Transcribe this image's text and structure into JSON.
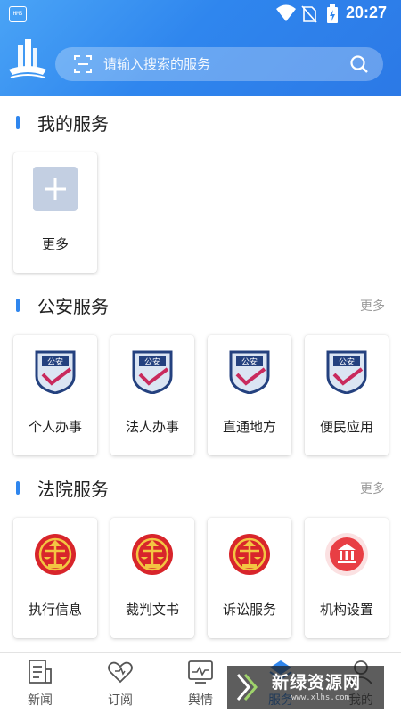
{
  "status_bar": {
    "time": "20:27",
    "sim_label": "HMS"
  },
  "search": {
    "placeholder": "请输入搜索的服务"
  },
  "my_services": {
    "title": "我的服务",
    "items": [
      {
        "label": "更多",
        "icon": "plus-icon"
      }
    ]
  },
  "police_services": {
    "title": "公安服务",
    "more": "更多",
    "badge_text": "公安",
    "items": [
      {
        "label": "个人办事",
        "icon": "police-badge-icon"
      },
      {
        "label": "法人办事",
        "icon": "police-badge-icon"
      },
      {
        "label": "直通地方",
        "icon": "police-badge-icon"
      },
      {
        "label": "便民应用",
        "icon": "police-badge-icon"
      }
    ]
  },
  "court_services": {
    "title": "法院服务",
    "more": "更多",
    "items": [
      {
        "label": "执行信息",
        "icon": "court-emblem-icon"
      },
      {
        "label": "裁判文书",
        "icon": "court-emblem-icon"
      },
      {
        "label": "诉讼服务",
        "icon": "court-emblem-icon"
      },
      {
        "label": "机构设置",
        "icon": "building-icon"
      }
    ]
  },
  "tabbar": {
    "tabs": [
      {
        "label": "新闻",
        "icon": "news-icon",
        "active": false
      },
      {
        "label": "订阅",
        "icon": "heart-icon",
        "active": false
      },
      {
        "label": "舆情",
        "icon": "monitor-icon",
        "active": false
      },
      {
        "label": "服务",
        "icon": "service-icon",
        "active": true
      },
      {
        "label": "我的",
        "icon": "user-icon",
        "active": false
      }
    ]
  },
  "watermark": {
    "text": "新绿资源网",
    "sub": "www.xlhs.com"
  },
  "colors": {
    "primary": "#2f86ee",
    "header_gradient_start": "#4aa4f6",
    "court_red": "#d8252b",
    "police_navy": "#24417f"
  }
}
